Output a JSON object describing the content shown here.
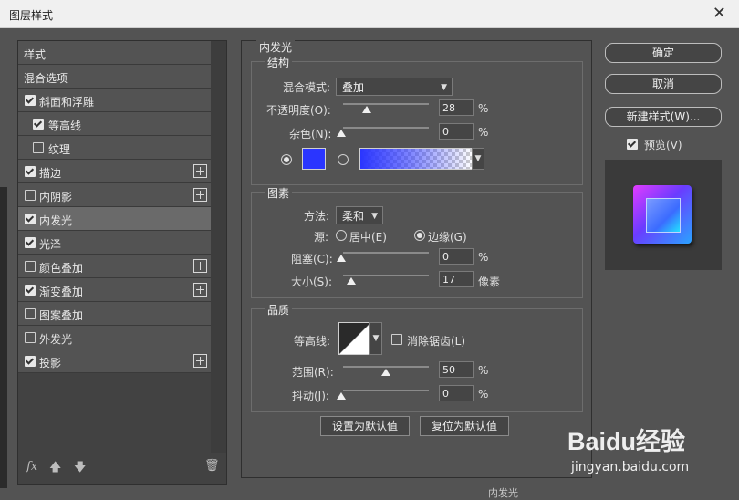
{
  "window": {
    "title": "图层样式"
  },
  "left_list": {
    "items": [
      {
        "label": "样式",
        "checkbox": null,
        "plus": false,
        "selected": false,
        "indent": 0
      },
      {
        "label": "混合选项",
        "checkbox": null,
        "plus": false,
        "selected": false,
        "indent": 0
      },
      {
        "label": "斜面和浮雕",
        "checkbox": true,
        "plus": false,
        "selected": false,
        "indent": 0
      },
      {
        "label": "等高线",
        "checkbox": true,
        "plus": false,
        "selected": false,
        "indent": 1
      },
      {
        "label": "纹理",
        "checkbox": false,
        "plus": false,
        "selected": false,
        "indent": 1
      },
      {
        "label": "描边",
        "checkbox": true,
        "plus": true,
        "selected": false,
        "indent": 0
      },
      {
        "label": "内阴影",
        "checkbox": false,
        "plus": true,
        "selected": false,
        "indent": 0
      },
      {
        "label": "内发光",
        "checkbox": true,
        "plus": false,
        "selected": true,
        "indent": 0
      },
      {
        "label": "光泽",
        "checkbox": true,
        "plus": false,
        "selected": false,
        "indent": 0
      },
      {
        "label": "颜色叠加",
        "checkbox": false,
        "plus": true,
        "selected": false,
        "indent": 0
      },
      {
        "label": "渐变叠加",
        "checkbox": true,
        "plus": true,
        "selected": false,
        "indent": 0
      },
      {
        "label": "图案叠加",
        "checkbox": false,
        "plus": false,
        "selected": false,
        "indent": 0
      },
      {
        "label": "外发光",
        "checkbox": false,
        "plus": false,
        "selected": false,
        "indent": 0
      },
      {
        "label": "投影",
        "checkbox": true,
        "plus": true,
        "selected": false,
        "indent": 0
      }
    ],
    "footer": {
      "fx": "fx"
    }
  },
  "panel": {
    "title": "内发光",
    "structure": {
      "title": "结构",
      "blend_label": "混合模式:",
      "blend_value": "叠加",
      "opacity_label": "不透明度(O):",
      "opacity_value": "28",
      "opacity_unit": "%",
      "noise_label": "杂色(N):",
      "noise_value": "0",
      "noise_unit": "%",
      "color_swatch": "#2a35ff",
      "gradient_start": "#2a35ff"
    },
    "elements": {
      "title": "图素",
      "method_label": "方法:",
      "method_value": "柔和",
      "source_label": "源:",
      "source_center": "居中(E)",
      "source_edge": "边缘(G)",
      "choke_label": "阻塞(C):",
      "choke_value": "0",
      "choke_unit": "%",
      "size_label": "大小(S):",
      "size_value": "17",
      "size_unit": "像素"
    },
    "quality": {
      "title": "品质",
      "contour_label": "等高线:",
      "antialias_label": "消除锯齿(L)",
      "range_label": "范围(R):",
      "range_value": "50",
      "range_unit": "%",
      "jitter_label": "抖动(J):",
      "jitter_value": "0",
      "jitter_unit": "%"
    },
    "buttons": {
      "set_default": "设置为默认值",
      "reset_default": "复位为默认值"
    }
  },
  "right": {
    "ok": "确定",
    "cancel": "取消",
    "new_style": "新建样式(W)...",
    "preview_label": "预览(V)"
  },
  "background": {
    "bottom_text": "内发光"
  },
  "watermark": {
    "line1": "Baidu经验",
    "line2": "jingyan.baidu.com"
  }
}
